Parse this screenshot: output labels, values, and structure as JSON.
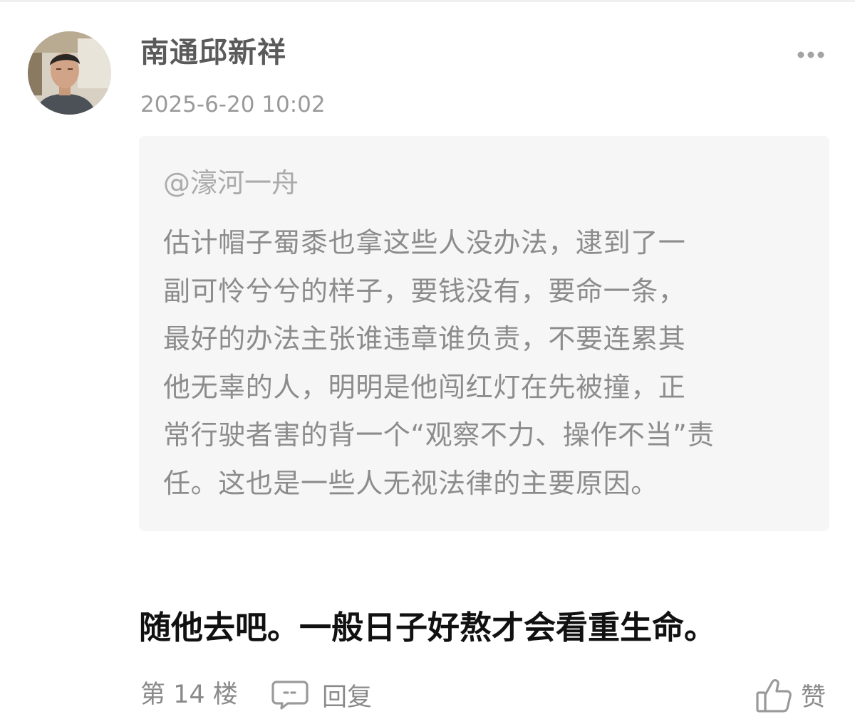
{
  "comment": {
    "author": "南通邱新祥",
    "timestamp": "2025-6-20 10:02",
    "quote": {
      "mention": "@濠河一舟",
      "lines": [
        "估计帽子蜀黍也拿这些人没办法，逮到了一",
        "副可怜兮兮的样子，要钱没有，要命一条，",
        "最好的办法主张谁违章谁负责，不要连累其",
        "他无辜的人，明明是他闯红灯在先被撞，正",
        "常行驶者害的背一个“观察不力、操作不当”责",
        "任。这也是一些人无视法律的主要原因。"
      ]
    },
    "reply_text": "随他去吧。一般日子好熬才会看重生命。",
    "floor": "第 14 楼",
    "reply_label": "回复",
    "like_label": "赞"
  },
  "icons": {
    "more": "more-dots-icon",
    "reply": "comment-bubble-icon",
    "like": "thumbs-up-icon"
  },
  "colors": {
    "author": "#5a5a5a",
    "timestamp": "#9a9a9a",
    "quote_background": "#f6f6f6",
    "quote_text": "#8c8c8c",
    "reply_text": "#111111",
    "footer": "#8a8a8a"
  }
}
